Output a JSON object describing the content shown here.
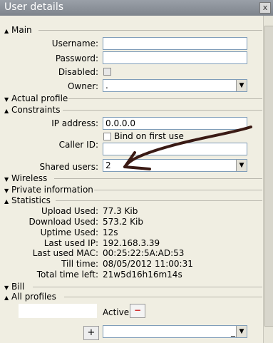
{
  "window": {
    "title": "User details",
    "close_glyph": "x"
  },
  "sections": {
    "main": "Main",
    "actual_profile": "Actual profile",
    "constraints": "Constraints",
    "wireless": "Wireless",
    "private_information": "Private information",
    "statistics": "Statistics",
    "bill": "Bill",
    "all_profiles": "All profiles"
  },
  "main": {
    "username_label": "Username:",
    "password_label": "Password:",
    "disabled_label": "Disabled:",
    "owner_label": "Owner:",
    "owner_value": "."
  },
  "constraints": {
    "ip_label": "IP address:",
    "ip_value": "0.0.0.0",
    "bind_label": "Bind on first use",
    "caller_label": "Caller ID:",
    "shared_label": "Shared users:",
    "shared_value": "2"
  },
  "statistics": {
    "rows": [
      {
        "label": "Upload Used:",
        "value": "77.3 Kib"
      },
      {
        "label": "Download Used:",
        "value": "573.2 Kib"
      },
      {
        "label": "Uptime Used:",
        "value": "12s"
      },
      {
        "label": "Last used IP:",
        "value": "192.168.3.39"
      },
      {
        "label": "Last used MAC:",
        "value": "00:25:22:5A:AD:53"
      },
      {
        "label": "Till time:",
        "value": "08/05/2012 11:00:31"
      },
      {
        "label": "Total time left:",
        "value": "21w5d16h16m14s"
      }
    ]
  },
  "profiles": {
    "status": "Active",
    "add_glyph": "+",
    "remove_glyph": "−",
    "select_value": "_"
  },
  "icons": {
    "collapsed": "▼",
    "expanded": "▲",
    "dropdown": "▼"
  },
  "colors": {
    "arrow": "#3a1a14",
    "remove_button": "#cc2222"
  }
}
